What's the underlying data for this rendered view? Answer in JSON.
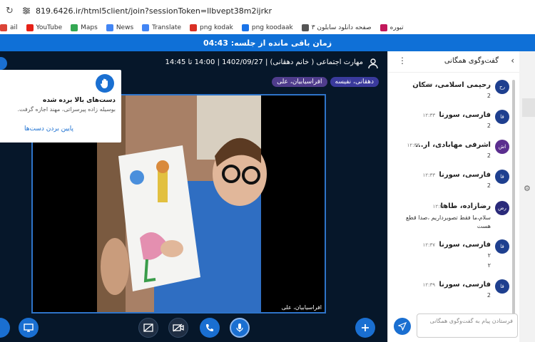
{
  "browser": {
    "url": "819.6426.ir/html5client/join?sessionToken=llbvept38m2ijrkr",
    "bookmarks": [
      {
        "label": "ail",
        "color": "#db4437"
      },
      {
        "label": "YouTube",
        "color": "#e62117"
      },
      {
        "label": "Maps",
        "color": "#34a853"
      },
      {
        "label": "News",
        "color": "#4285f4"
      },
      {
        "label": "Translate",
        "color": "#4285f4"
      },
      {
        "label": "png kodak",
        "color": "#d93025"
      },
      {
        "label": "png koodaak",
        "color": "#1a73e8"
      },
      {
        "label": "صفحه دانلود سابلون ۳",
        "color": "#555555"
      },
      {
        "label": "تبوره",
        "color": "#c2185b"
      }
    ]
  },
  "session": {
    "timer_text": "زمان باقی مانده از جلسه: 04:43",
    "meeting_title": "مهارت اجتماعی ( خانم دهقانی) | 1402/09/27 | 14:00 تا 14:45"
  },
  "presenters": [
    "دهقانی، نفیسه",
    "افراسیابیان، علی"
  ],
  "raise_hand": {
    "title": "دست‌های بالا برده شده",
    "description": "بوسیله زاده پیرسراتی، مهند اجازه گرفت.",
    "lower_label": "پایین بردن دست‌ها"
  },
  "video": {
    "label": "افراسیابیان، علی"
  },
  "chat": {
    "title": "گفت‌وگوی همگانی",
    "input_placeholder": "فرستادن پیام به گفت‌وگوی همگانی",
    "messages": [
      {
        "initials": "رح",
        "name": "رحیمی اسلامی، سکان",
        "time": "۱۲:۳۳",
        "text": "2",
        "avatar_color": "#1e3f8f"
      },
      {
        "initials": "فا",
        "name": "فارسی، سورنا",
        "time": "۱۲:۳۳",
        "text": "2",
        "avatar_color": "#1e3f8f"
      },
      {
        "initials": "اش",
        "name": "اشرفی مهابادی، ار...",
        "time": "۱۲:۳۳",
        "text": "2",
        "avatar_color": "#5b2e8f"
      },
      {
        "initials": "فا",
        "name": "فارسی، سورنا",
        "time": "۱۲:۳۳",
        "text": "2",
        "avatar_color": "#1e3f8f"
      },
      {
        "initials": "رض",
        "name": "رضازاده، طاها",
        "time": "۱۲:۲۵",
        "text": "سلام،ما فقط تصویرداریم ،صدا قطع هست",
        "avatar_color": "#2a2a7a"
      },
      {
        "initials": "فا",
        "name": "فارسی، سورنا",
        "time": "۱۲:۳۷",
        "text": "۲",
        "text2": "۲",
        "avatar_color": "#1e3f8f"
      },
      {
        "initials": "فا",
        "name": "فارسی، سورنا",
        "time": "۱۲:۳۹",
        "text": "2",
        "avatar_color": "#1e3f8f"
      }
    ]
  },
  "icons": {
    "user": "user-icon",
    "hand": "hand-icon",
    "send": "send-icon",
    "settings": "gear-icon"
  }
}
